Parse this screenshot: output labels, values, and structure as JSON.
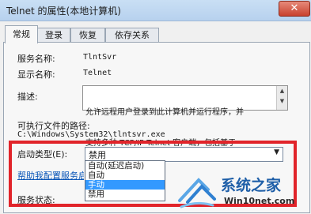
{
  "window": {
    "title": "Telnet 的属性(本地计算机)",
    "close_glyph": "✕"
  },
  "tabs": [
    {
      "label": "常规"
    },
    {
      "label": "登录"
    },
    {
      "label": "恢复"
    },
    {
      "label": "依存关系"
    }
  ],
  "fields": {
    "service_name_label": "服务名称:",
    "service_name_value": "TlntSvr",
    "display_name_label": "显示名称:",
    "display_name_value": "Telnet",
    "description_label": "描述:",
    "description_lines": [
      "允许远程用户登录到此计算机并运行程序，并",
      "支持多种 TCP/IP Telnet 客户端，包括基于"
    ],
    "exe_path_label": "可执行文件的路径:",
    "exe_path_value": "C:\\Windows\\System32\\tlntsvr.exe",
    "startup_type_label": "启动类型(E):",
    "startup_type_value": "禁用",
    "help_link": "帮助我配置服务启",
    "service_status_label": "服务状态:"
  },
  "dropdown_options": [
    {
      "label": "自动(延迟启动)",
      "selected": false
    },
    {
      "label": "自动",
      "selected": false
    },
    {
      "label": "手动",
      "selected": true
    },
    {
      "label": "禁用",
      "selected": false
    }
  ],
  "watermark": {
    "brand": "系统之家",
    "url": "Win10net.com"
  },
  "colors": {
    "highlight_frame": "#e1242a",
    "selection": "#3399ff",
    "link": "#0a56b8"
  }
}
